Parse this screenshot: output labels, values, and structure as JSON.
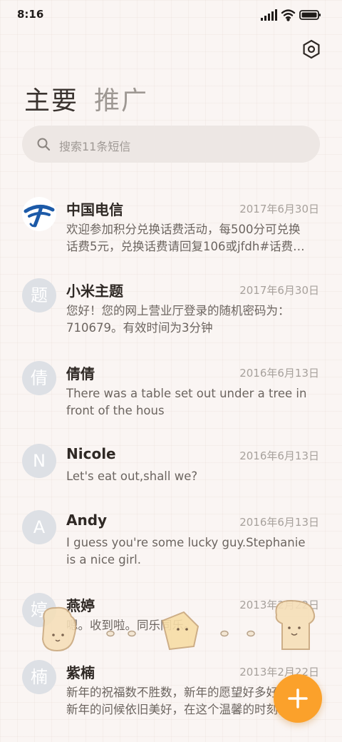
{
  "status_bar": {
    "time": "8:16"
  },
  "tabs": {
    "primary": "主要",
    "promotions": "推广"
  },
  "search": {
    "placeholder": "搜索11条短信"
  },
  "colors": {
    "fab": "#fba12b",
    "avatar_bg": "#dde0e5",
    "telecom_logo": "#1c5aa8"
  },
  "messages": [
    {
      "avatar": "",
      "avatar_icon": "china-telecom-logo-icon",
      "sender": "中国电信",
      "date": "2017年6月30日",
      "preview": "欢迎参加积分兑换话费活动，每500分可兑换\n话费5元，兑换话费请回复106或jfdh#话费…"
    },
    {
      "avatar": "题",
      "sender": "小米主题",
      "date": "2017年6月30日",
      "preview": "您好！您的网上营业厅登录的随机密码为：\n710679。有效时间为3分钟"
    },
    {
      "avatar": "倩",
      "sender": "倩倩",
      "date": "2016年6月13日",
      "preview": "There was a table set out under a tree in\nfront of the hous"
    },
    {
      "avatar": "N",
      "sender": "Nicole",
      "date": "2016年6月13日",
      "preview": "Let's eat out,shall we?"
    },
    {
      "avatar": "A",
      "sender": "Andy",
      "date": "2016年6月13日",
      "preview": "I guess you're some lucky guy.Stephanie\nis a nice girl."
    },
    {
      "avatar": "婷",
      "sender": "燕婷",
      "date": "2013年2月22日",
      "preview": "嗯。收到啦。同乐同乐。"
    },
    {
      "avatar": "楠",
      "sender": "紫楠",
      "date": "2013年2月22日",
      "preview": "新年的祝福数不胜数，新年的愿望好多好多，\n新年的问候依旧美好，在这个温馨的时刻，"
    }
  ]
}
